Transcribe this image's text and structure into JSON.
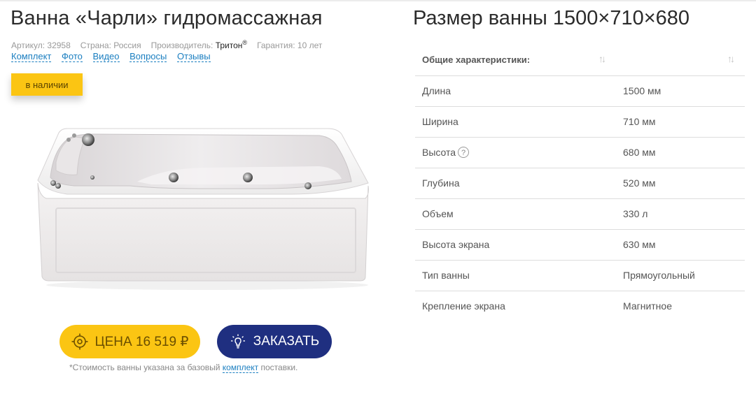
{
  "product": {
    "title": "Ванна «Чарли» гидромассажная",
    "meta": {
      "article": "Артикул: 32958",
      "country": "Страна: Россия",
      "manufacturer_label": "Производитель: ",
      "manufacturer_name": "Тритон",
      "manufacturer_mark": "®",
      "warranty": "Гарантия: 10 лет"
    },
    "tabs": [
      "Комплект",
      "Фото",
      "Видео",
      "Вопросы",
      "Отзывы"
    ],
    "stock_label": "в наличии",
    "price_label": "ЦЕНА 16 519 ₽",
    "order_label": "ЗАКАЗАТЬ",
    "footnote_before": "*Стоимость ванны указана за базовый ",
    "footnote_link": "комплект",
    "footnote_after": " поставки."
  },
  "specs": {
    "title": "Размер ванны 1500×710×680",
    "header": "Общие характеристики:",
    "sort_glyph": "↑↓",
    "help_glyph": "?",
    "rows": [
      {
        "label": "Длина",
        "value": "1500 мм"
      },
      {
        "label": "Ширина",
        "value": "710 мм"
      },
      {
        "label": "Высота",
        "value": "680 мм"
      },
      {
        "label": "Глубина",
        "value": "520 мм"
      },
      {
        "label": "Объем",
        "value": "330 л"
      },
      {
        "label": "Высота экрана",
        "value": "630 мм"
      },
      {
        "label": "Тип ванны",
        "value": "Прямоугольный"
      },
      {
        "label": "Крепление экрана",
        "value": "Магнитное"
      }
    ]
  },
  "colors": {
    "accent_yellow": "#fbc513",
    "order_blue": "#1f2f80",
    "link_blue": "#1a7ec0"
  },
  "icons": {
    "price_button": "target-icon",
    "order_button": "lightbulb-icon",
    "help": "help-circle-icon",
    "sort": "sort-icon"
  }
}
